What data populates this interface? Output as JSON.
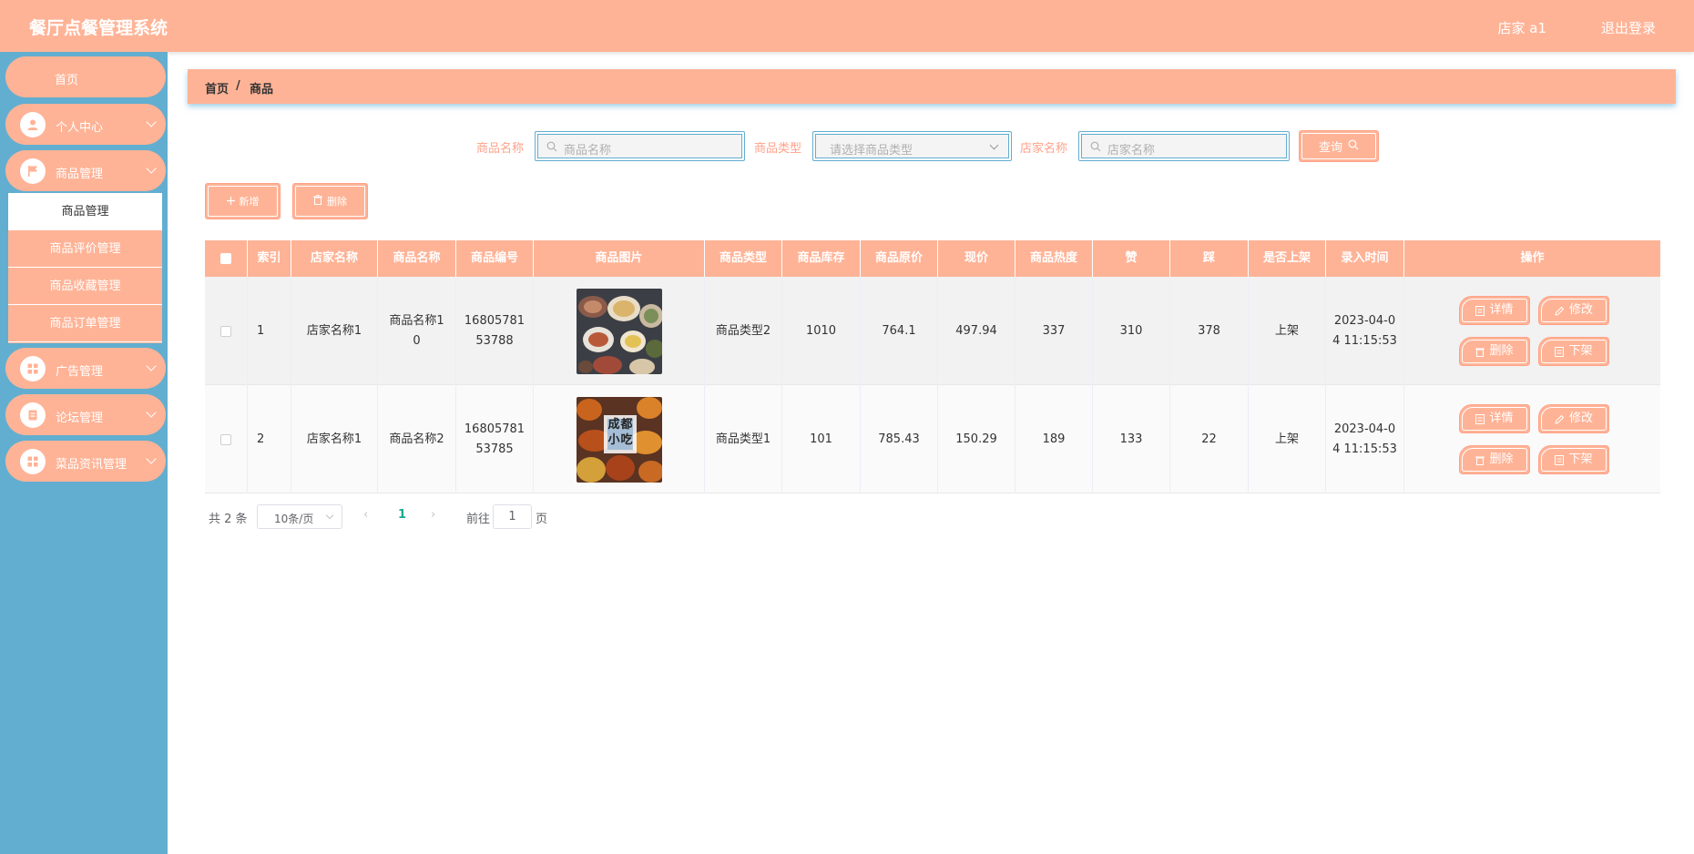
{
  "header": {
    "title": "餐厅点餐管理系统",
    "user": "店家 a1",
    "logout": "退出登录"
  },
  "sidebar": {
    "items": [
      {
        "label": "首页"
      },
      {
        "label": "个人中心"
      },
      {
        "label": "商品管理"
      },
      {
        "label": "广告管理"
      },
      {
        "label": "论坛管理"
      },
      {
        "label": "菜品资讯管理"
      }
    ],
    "submenu": [
      {
        "label": "商品管理"
      },
      {
        "label": "商品评价管理"
      },
      {
        "label": "商品收藏管理"
      },
      {
        "label": "商品订单管理"
      }
    ]
  },
  "breadcrumb": {
    "home": "首页",
    "sep": "/",
    "current": "商品"
  },
  "search": {
    "name_label": "商品名称",
    "name_placeholder": "商品名称",
    "type_label": "商品类型",
    "type_placeholder": "请选择商品类型",
    "shop_label": "店家名称",
    "shop_placeholder": "店家名称",
    "query_button": "查询"
  },
  "toolbar": {
    "add": "新增",
    "delete": "删除"
  },
  "table": {
    "headers": [
      "索引",
      "店家名称",
      "商品名称",
      "商品编号",
      "商品图片",
      "商品类型",
      "商品库存",
      "商品原价",
      "现价",
      "商品热度",
      "赞",
      "踩",
      "是否上架",
      "录入时间",
      "操作"
    ],
    "rows": [
      {
        "index": "1",
        "shop": "店家名称1",
        "name_l1": "商品名称1",
        "name_l2": "0",
        "code_l1": "16805781",
        "code_l2": "53788",
        "type": "商品类型2",
        "stock": "1010",
        "orig": "764.1",
        "price": "497.94",
        "heat": "337",
        "like": "310",
        "dislike": "378",
        "onsale": "上架",
        "time_l1": "2023-04-0",
        "time_l2": "4 11:15:53"
      },
      {
        "index": "2",
        "shop": "店家名称1",
        "name_l1": "商品名称2",
        "name_l2": "",
        "code_l1": "16805781",
        "code_l2": "53785",
        "type": "商品类型1",
        "stock": "101",
        "orig": "785.43",
        "price": "150.29",
        "heat": "189",
        "like": "133",
        "dislike": "22",
        "onsale": "上架",
        "time_l1": "2023-04-0",
        "time_l2": "4 11:15:53",
        "image_text": "成都小吃"
      }
    ],
    "actions": {
      "detail": "详情",
      "edit": "修改",
      "delete": "删除",
      "off": "下架"
    }
  },
  "pagination": {
    "total": "共 2 条",
    "page_size": "10条/页",
    "current": "1",
    "goto": "前往",
    "goto_value": "1",
    "page_suffix": "页"
  }
}
